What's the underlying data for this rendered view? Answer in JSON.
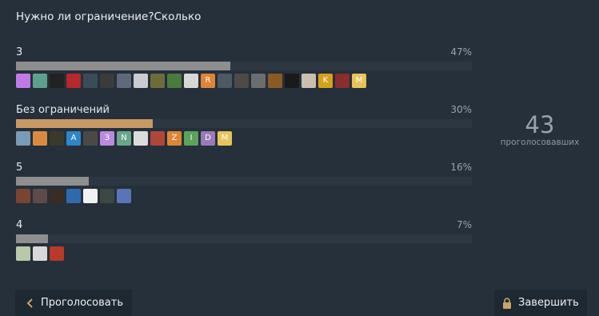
{
  "poll": {
    "question": "Нужно ли ограничение?Сколько",
    "total_votes": "43",
    "total_label": "проголосовавших"
  },
  "options": [
    {
      "label": "3",
      "percent_text": "47%",
      "percent": 47,
      "winner": false,
      "voter_avatars": [
        {
          "letter": "",
          "color": "#c07ae8"
        },
        {
          "letter": "",
          "color": "#5da18c"
        },
        {
          "letter": "",
          "color": "#222222"
        },
        {
          "letter": "",
          "color": "#b5282b"
        },
        {
          "letter": "",
          "color": "#3a4c58"
        },
        {
          "letter": "",
          "color": "#3b3b3b"
        },
        {
          "letter": "",
          "color": "#5e6a7c"
        },
        {
          "letter": "",
          "color": "#c8ccd0"
        },
        {
          "letter": "",
          "color": "#6e6b3a"
        },
        {
          "letter": "",
          "color": "#4a7a3c"
        },
        {
          "letter": "",
          "color": "#d8d8d8"
        },
        {
          "letter": "R",
          "color": "#e08535"
        },
        {
          "letter": "",
          "color": "#4d5a63"
        },
        {
          "letter": "",
          "color": "#504a46"
        },
        {
          "letter": "",
          "color": "#6a6e70"
        },
        {
          "letter": "",
          "color": "#8a5a25"
        },
        {
          "letter": "",
          "color": "#1a1a1a"
        },
        {
          "letter": "",
          "color": "#cabfae"
        },
        {
          "letter": "K",
          "color": "#d4a21a"
        },
        {
          "letter": "",
          "color": "#8a2d2d"
        },
        {
          "letter": "M",
          "color": "#e8c35a"
        }
      ]
    },
    {
      "label": "Без ограничений",
      "percent_text": "30%",
      "percent": 30,
      "winner": true,
      "voter_avatars": [
        {
          "letter": "",
          "color": "#7a9bb5"
        },
        {
          "letter": "",
          "color": "#d98a3e"
        },
        {
          "letter": "",
          "color": "#3a3a2c"
        },
        {
          "letter": "A",
          "color": "#2c86c8"
        },
        {
          "letter": "",
          "color": "#4a4a44"
        },
        {
          "letter": "З",
          "color": "#b98ae0"
        },
        {
          "letter": "N",
          "color": "#6aa78a"
        },
        {
          "letter": "",
          "color": "#dcdcdc"
        },
        {
          "letter": "",
          "color": "#b0453a"
        },
        {
          "letter": "Z",
          "color": "#e08535"
        },
        {
          "letter": "I",
          "color": "#5ba35a"
        },
        {
          "letter": "D",
          "color": "#9a7ab8"
        },
        {
          "letter": "M",
          "color": "#e8c35a"
        }
      ]
    },
    {
      "label": "5",
      "percent_text": "16%",
      "percent": 16,
      "winner": false,
      "voter_avatars": [
        {
          "letter": "",
          "color": "#7a4433"
        },
        {
          "letter": "",
          "color": "#5e4a48"
        },
        {
          "letter": "",
          "color": "#3a2c22"
        },
        {
          "letter": "",
          "color": "#2e6ab0"
        },
        {
          "letter": "",
          "color": "#f2f2f2"
        },
        {
          "letter": "",
          "color": "#3a4a40"
        },
        {
          "letter": "",
          "color": "#5a74b8"
        }
      ]
    },
    {
      "label": "4",
      "percent_text": "7%",
      "percent": 7,
      "winner": false,
      "voter_avatars": [
        {
          "letter": "",
          "color": "#b8c8a8"
        },
        {
          "letter": "",
          "color": "#d8d8d8"
        },
        {
          "letter": "",
          "color": "#b83a28"
        }
      ]
    }
  ],
  "buttons": {
    "vote_label": "Проголосовать",
    "vote_icon": "chevron-left-icon",
    "finish_label": "Завершить",
    "finish_icon": "lock-icon"
  },
  "colors": {
    "background": "#25303a",
    "bar_default": "#8e8e8e",
    "bar_winner": "#c79a63",
    "track": "#2c3741"
  }
}
